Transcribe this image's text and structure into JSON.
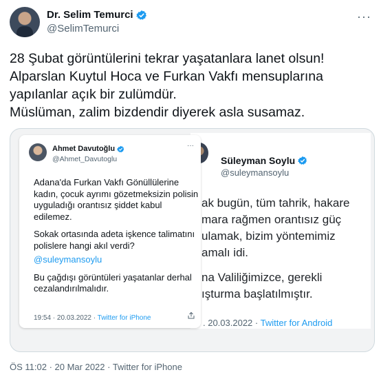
{
  "author": {
    "name": "Dr. Selim Temurci",
    "handle": "@SelimTemurci"
  },
  "menu": {
    "more": "···"
  },
  "tweet": {
    "lines": [
      "28 Şubat görüntülerini tekrar yaşatanlara lanet olsun!",
      "Alparslan Kuytul Hoca ve Furkan Vakfı mensuplarına",
      "yapılanlar açık bir zulümdür.",
      "Müslüman, zalim bizdendir diyerek asla susamaz."
    ]
  },
  "embedded_left": {
    "name": "Ahmet Davutoğlu",
    "handle": "@Ahmet_Davutoglu",
    "more": "···",
    "paragraphs": [
      "Adana'da Furkan Vakfı Gönüllülerine kadın, çocuk ayrımı gözetmeksizin polisin uyguladığı orantısız şiddet kabul edilemez.",
      "Sokak ortasında adeta işkence talimatını polislere hangi akıl verdi?",
      "Bu çağdışı görüntüleri yaşatanlar derhal cezalandırılmalıdır."
    ],
    "mention": "@suleymansoylu",
    "meta": "19:54 · 20.03.2022 · ",
    "source": "Twitter for iPhone"
  },
  "embedded_right": {
    "name": "Süleyman Soylu",
    "handle": "@suleymansoylu",
    "lines": [
      "ak bugün, tüm tahrik, hakare",
      "mara rağmen orantısız güç",
      "ulamak, bizim yöntemimiz",
      "amalı idi.",
      "na Valiliğimizce, gerekli",
      "ışturma başlatılmıştır."
    ],
    "meta": ". 20.03.2022 · ",
    "source": "Twitter for Android"
  },
  "footer": {
    "meta": "ÖS 11:02 · 20 Mar 2022 · Twitter for iPhone"
  },
  "colors": {
    "link": "#1d9bf0",
    "verified": "#1d9bf0",
    "muted": "#536471"
  }
}
